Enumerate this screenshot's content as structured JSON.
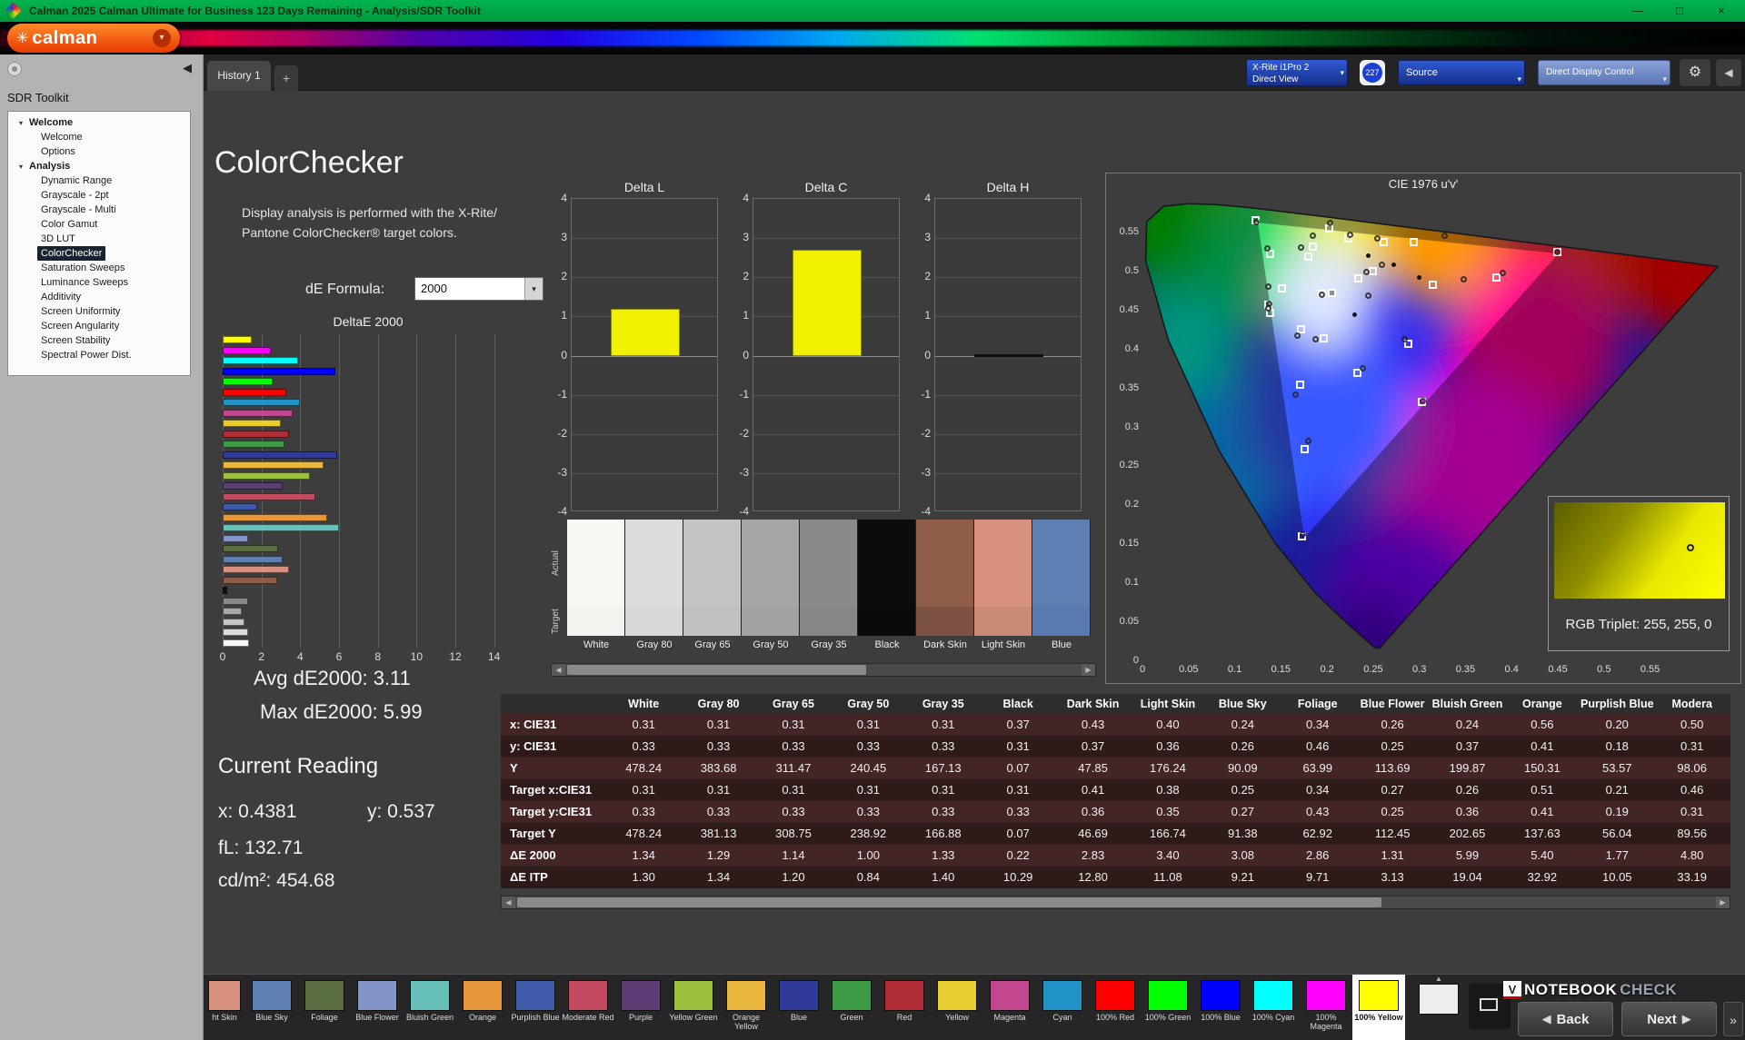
{
  "window": {
    "title": "Calman 2025 Calman Ultimate for Business 123 Days Remaining  - Analysis/SDR Toolkit",
    "controls": {
      "min": "—",
      "max": "□",
      "close": "×"
    }
  },
  "logo": {
    "text": "calman"
  },
  "icons": {
    "expanded": "▾",
    "dropdown": "▾",
    "left": "◀",
    "right": "▶",
    "up": "▲",
    "back": "◀",
    "next": "▶",
    "more": "»",
    "gear": "⚙",
    "plus": "+",
    "flower": "✳",
    "collapse_left": "◀"
  },
  "sidebar": {
    "title": "SDR Toolkit",
    "sections": [
      {
        "label": "Welcome",
        "items": [
          {
            "label": "Welcome"
          },
          {
            "label": "Options"
          }
        ]
      },
      {
        "label": "Analysis",
        "items": [
          {
            "label": "Dynamic Range"
          },
          {
            "label": "Grayscale - 2pt"
          },
          {
            "label": "Grayscale - Multi"
          },
          {
            "label": "Color Gamut"
          },
          {
            "label": "3D LUT"
          },
          {
            "label": "ColorChecker",
            "selected": true
          },
          {
            "label": "Saturation Sweeps"
          },
          {
            "label": "Luminance Sweeps"
          },
          {
            "label": "Additivity"
          },
          {
            "label": "Screen Uniformity"
          },
          {
            "label": "Screen Angularity"
          },
          {
            "label": "Screen Stability"
          },
          {
            "label": "Spectral Power Dist."
          }
        ]
      }
    ]
  },
  "toolbar": {
    "tab": "History 1",
    "meter": {
      "line1": "X-Rite i1Pro 2",
      "line2": "Direct View"
    },
    "badge": "227",
    "source_label": "Source",
    "ddc_label": "Direct Display Control"
  },
  "main": {
    "title": "ColorChecker",
    "description_line1": "Display analysis is performed with the X-Rite/",
    "description_line2": "Pantone ColorChecker® target colors.",
    "de_formula_label": "dE Formula:",
    "de_formula_value": "2000",
    "avg": "Avg dE2000: 3.11",
    "max": "Max dE2000: 5.99",
    "current_reading": {
      "title": "Current Reading",
      "x": "x: 0.4381",
      "y": "y: 0.537",
      "fl": "fL: 132.71",
      "cd": "cd/m²: 454.68"
    },
    "rgb_triplet": "RGB Triplet: 255, 255, 0"
  },
  "chart_data": [
    {
      "type": "bar",
      "orientation": "horizontal",
      "title": "DeltaE 2000",
      "xlim": [
        0,
        15
      ],
      "xticks": [
        0,
        2,
        4,
        6,
        8,
        10,
        12,
        14
      ],
      "note": "bars listed top-to-bottom; values are dE2000 per patch",
      "bars": [
        {
          "name": "100% Yellow",
          "value": 1.5,
          "color": "#ffff00"
        },
        {
          "name": "100% Magenta",
          "value": 2.5,
          "color": "#ff00ff"
        },
        {
          "name": "100% Cyan",
          "value": 3.9,
          "color": "#00ffff"
        },
        {
          "name": "100% Blue",
          "value": 5.8,
          "color": "#0000ff"
        },
        {
          "name": "100% Green",
          "value": 2.6,
          "color": "#00ff00"
        },
        {
          "name": "100% Red",
          "value": 3.3,
          "color": "#ff0000"
        },
        {
          "name": "Cyan",
          "value": 4.0,
          "color": "#1f93c6"
        },
        {
          "name": "Magenta",
          "value": 3.6,
          "color": "#c2478f"
        },
        {
          "name": "Yellow",
          "value": 3.0,
          "color": "#e8cc30"
        },
        {
          "name": "Red",
          "value": 3.4,
          "color": "#b02d37"
        },
        {
          "name": "Green",
          "value": 3.2,
          "color": "#3e9b45"
        },
        {
          "name": "Blue",
          "value": 5.9,
          "color": "#2f3a99"
        },
        {
          "name": "Orange Yellow",
          "value": 5.2,
          "color": "#e9b83c"
        },
        {
          "name": "Yellow Green",
          "value": 4.5,
          "color": "#9cc13c"
        },
        {
          "name": "Purple",
          "value": 3.1,
          "color": "#5e3c74"
        },
        {
          "name": "Moderate Red",
          "value": 4.8,
          "color": "#c34a5e"
        },
        {
          "name": "Purplish Blue",
          "value": 1.77,
          "color": "#3f5aa8"
        },
        {
          "name": "Orange",
          "value": 5.4,
          "color": "#e8963a"
        },
        {
          "name": "Bluish Green",
          "value": 5.99,
          "color": "#68c1b8"
        },
        {
          "name": "Blue Flower",
          "value": 1.31,
          "color": "#8295c8"
        },
        {
          "name": "Foliage",
          "value": 2.86,
          "color": "#5a6e41"
        },
        {
          "name": "Blue Sky",
          "value": 3.08,
          "color": "#5d7fb2"
        },
        {
          "name": "Light Skin",
          "value": 3.4,
          "color": "#d8917e"
        },
        {
          "name": "Dark Skin",
          "value": 2.83,
          "color": "#8f5c49"
        },
        {
          "name": "Black",
          "value": 0.22,
          "color": "#141414"
        },
        {
          "name": "Gray 35",
          "value": 1.33,
          "color": "#8a8a8a"
        },
        {
          "name": "Gray 50",
          "value": 1.0,
          "color": "#a8a8a6"
        },
        {
          "name": "Gray 65",
          "value": 1.14,
          "color": "#c6c6c4"
        },
        {
          "name": "Gray 80",
          "value": 1.29,
          "color": "#dcdcdc"
        },
        {
          "name": "White",
          "value": 1.34,
          "color": "#f5f5f2"
        }
      ]
    },
    {
      "type": "bar",
      "title": "Delta L",
      "ylim": [
        -4,
        4
      ],
      "yticks": [
        4,
        3,
        2,
        1,
        0,
        -1,
        -2,
        -3,
        -4
      ],
      "values": [
        1.2
      ],
      "bar_color": "#f0f000"
    },
    {
      "type": "bar",
      "title": "Delta C",
      "ylim": [
        -4,
        4
      ],
      "yticks": [
        4,
        3,
        2,
        1,
        0,
        -1,
        -2,
        -3,
        -4
      ],
      "values": [
        2.7
      ],
      "bar_color": "#f0f000"
    },
    {
      "type": "bar",
      "title": "Delta H",
      "ylim": [
        -4,
        4
      ],
      "yticks": [
        4,
        3,
        2,
        1,
        0,
        -1,
        -2,
        -3,
        -4
      ],
      "values": [
        -0.05
      ],
      "bar_color": "#101010"
    },
    {
      "type": "scatter",
      "title": "CIE 1976 u'v'",
      "xlim": [
        0,
        0.64
      ],
      "ylim": [
        0,
        0.6
      ],
      "xticks": [
        0,
        0.05,
        0.1,
        0.15,
        0.2,
        0.25,
        0.3,
        0.35,
        0.4,
        0.45,
        0.5,
        0.55
      ],
      "yticks": [
        0,
        0.05,
        0.1,
        0.15,
        0.2,
        0.25,
        0.3,
        0.35,
        0.4,
        0.45,
        0.5,
        0.55
      ],
      "legend": {
        "square": "target",
        "circle": "measured"
      },
      "targets": [
        [
          0.196,
          0.469
        ],
        [
          0.252,
          0.498
        ],
        [
          0.236,
          0.489
        ],
        [
          0.174,
          0.423
        ],
        [
          0.182,
          0.517
        ],
        [
          0.198,
          0.412
        ],
        [
          0.153,
          0.476
        ],
        [
          0.296,
          0.535
        ],
        [
          0.173,
          0.352
        ],
        [
          0.317,
          0.481
        ],
        [
          0.235,
          0.368
        ],
        [
          0.187,
          0.53
        ],
        [
          0.263,
          0.535
        ],
        [
          0.178,
          0.27
        ],
        [
          0.14,
          0.52
        ],
        [
          0.385,
          0.49
        ],
        [
          0.225,
          0.54
        ],
        [
          0.29,
          0.405
        ],
        [
          0.14,
          0.445
        ],
        [
          0.451,
          0.523
        ],
        [
          0.125,
          0.563
        ],
        [
          0.175,
          0.158
        ],
        [
          0.138,
          0.455
        ],
        [
          0.305,
          0.33
        ],
        [
          0.204,
          0.553
        ]
      ],
      "measured": [
        [
          0.196,
          0.468
        ],
        [
          0.247,
          0.467
        ],
        [
          0.261,
          0.506
        ],
        [
          0.245,
          0.497
        ],
        [
          0.17,
          0.415
        ],
        [
          0.174,
          0.528
        ],
        [
          0.19,
          0.411
        ],
        [
          0.138,
          0.478
        ],
        [
          0.329,
          0.543
        ],
        [
          0.168,
          0.34
        ],
        [
          0.35,
          0.488
        ],
        [
          0.241,
          0.373
        ],
        [
          0.187,
          0.543
        ],
        [
          0.256,
          0.54
        ],
        [
          0.182,
          0.28
        ],
        [
          0.137,
          0.527
        ],
        [
          0.392,
          0.496
        ],
        [
          0.227,
          0.545
        ],
        [
          0.286,
          0.411
        ],
        [
          0.138,
          0.45
        ],
        [
          0.451,
          0.522
        ],
        [
          0.126,
          0.561
        ],
        [
          0.176,
          0.16
        ],
        [
          0.139,
          0.456
        ],
        [
          0.306,
          0.331
        ],
        [
          0.205,
          0.56
        ]
      ],
      "reference_dots": [
        [
          0.245,
          0.52
        ],
        [
          0.272,
          0.508
        ],
        [
          0.3,
          0.492
        ],
        [
          0.23,
          0.445
        ]
      ],
      "selected": [
        0.207,
        0.47
      ]
    }
  ],
  "swatch_strip": {
    "row_labels": [
      "Actual",
      "Target"
    ],
    "patches": [
      {
        "label": "White",
        "actual": "#f7f7f4",
        "target": "#f2f2ef"
      },
      {
        "label": "Gray 80",
        "actual": "#dcdcdc",
        "target": "#d8d8d8"
      },
      {
        "label": "Gray 65",
        "actual": "#c4c4c2",
        "target": "#c0c0be"
      },
      {
        "label": "Gray 50",
        "actual": "#a6a6a4",
        "target": "#a2a2a0"
      },
      {
        "label": "Gray 35",
        "actual": "#8a8a8a",
        "target": "#868686"
      },
      {
        "label": "Black",
        "actual": "#0c0c0e",
        "target": "#0a0a0a"
      },
      {
        "label": "Dark Skin",
        "actual": "#8f5c49",
        "target": "#7d5243"
      },
      {
        "label": "Light Skin",
        "actual": "#d8917e",
        "target": "#c98a74"
      },
      {
        "label": "Blue",
        "actual": "#5d7fb2",
        "target": "#597ab0"
      }
    ]
  },
  "table": {
    "columns": [
      "White",
      "Gray 80",
      "Gray 65",
      "Gray 50",
      "Gray 35",
      "Black",
      "Dark Skin",
      "Light Skin",
      "Blue Sky",
      "Foliage",
      "Blue Flower",
      "Bluish Green",
      "Orange",
      "Purplish Blue",
      "Modera"
    ],
    "rows": [
      {
        "label": "x: CIE31",
        "values": [
          "0.31",
          "0.31",
          "0.31",
          "0.31",
          "0.31",
          "0.37",
          "0.43",
          "0.40",
          "0.24",
          "0.34",
          "0.26",
          "0.24",
          "0.56",
          "0.20",
          "0.50"
        ]
      },
      {
        "label": "y: CIE31",
        "values": [
          "0.33",
          "0.33",
          "0.33",
          "0.33",
          "0.33",
          "0.31",
          "0.37",
          "0.36",
          "0.26",
          "0.46",
          "0.25",
          "0.37",
          "0.41",
          "0.18",
          "0.31"
        ]
      },
      {
        "label": "Y",
        "values": [
          "478.24",
          "383.68",
          "311.47",
          "240.45",
          "167.13",
          "0.07",
          "47.85",
          "176.24",
          "90.09",
          "63.99",
          "113.69",
          "199.87",
          "150.31",
          "53.57",
          "98.06"
        ]
      },
      {
        "label": "Target x:CIE31",
        "values": [
          "0.31",
          "0.31",
          "0.31",
          "0.31",
          "0.31",
          "0.31",
          "0.41",
          "0.38",
          "0.25",
          "0.34",
          "0.27",
          "0.26",
          "0.51",
          "0.21",
          "0.46"
        ]
      },
      {
        "label": "Target y:CIE31",
        "values": [
          "0.33",
          "0.33",
          "0.33",
          "0.33",
          "0.33",
          "0.33",
          "0.36",
          "0.35",
          "0.27",
          "0.43",
          "0.25",
          "0.36",
          "0.41",
          "0.19",
          "0.31"
        ]
      },
      {
        "label": "Target Y",
        "values": [
          "478.24",
          "381.13",
          "308.75",
          "238.92",
          "166.88",
          "0.07",
          "46.69",
          "166.74",
          "91.38",
          "62.92",
          "112.45",
          "202.65",
          "137.63",
          "56.04",
          "89.56"
        ]
      },
      {
        "label": "ΔE 2000",
        "values": [
          "1.34",
          "1.29",
          "1.14",
          "1.00",
          "1.33",
          "0.22",
          "2.83",
          "3.40",
          "3.08",
          "2.86",
          "1.31",
          "5.99",
          "5.40",
          "1.77",
          "4.80"
        ]
      },
      {
        "label": "ΔE ITP",
        "values": [
          "1.30",
          "1.34",
          "1.20",
          "0.84",
          "1.40",
          "10.29",
          "12.80",
          "11.08",
          "9.21",
          "9.71",
          "3.13",
          "19.04",
          "32.92",
          "10.05",
          "33.19"
        ]
      }
    ]
  },
  "bottom_bar": {
    "patches": [
      {
        "label": "ht Skin",
        "color": "#d8917e"
      },
      {
        "label": "Blue Sky",
        "color": "#5d7fb2"
      },
      {
        "label": "Foliage",
        "color": "#5a6e41"
      },
      {
        "label": "Blue Flower",
        "color": "#8295c8"
      },
      {
        "label": "Bluish Green",
        "color": "#68c1b8"
      },
      {
        "label": "Orange",
        "color": "#e8963a"
      },
      {
        "label": "Purplish Blue",
        "color": "#3f5aa8"
      },
      {
        "label": "Moderate Red",
        "color": "#c34a5e"
      },
      {
        "label": "Purple",
        "color": "#5e3c74"
      },
      {
        "label": "Yellow Green",
        "color": "#9cc13c"
      },
      {
        "label": "Orange Yellow",
        "color": "#e9b83c"
      },
      {
        "label": "Blue",
        "color": "#2f3a99"
      },
      {
        "label": "Green",
        "color": "#3e9b45"
      },
      {
        "label": "Red",
        "color": "#b02d37"
      },
      {
        "label": "Yellow",
        "color": "#e8cc30"
      },
      {
        "label": "Magenta",
        "color": "#c2478f"
      },
      {
        "label": "Cyan",
        "color": "#1f93c6"
      },
      {
        "label": "100% Red",
        "color": "#ff0000"
      },
      {
        "label": "100% Green",
        "color": "#00ff00"
      },
      {
        "label": "100% Blue",
        "color": "#0000ff"
      },
      {
        "label": "100% Cyan",
        "color": "#00ffff"
      },
      {
        "label": "100% Magenta",
        "color": "#ff00ff"
      },
      {
        "label": "100% Yellow",
        "color": "#ffff00",
        "selected": true
      }
    ],
    "back": "Back",
    "next": "Next",
    "more": "»"
  },
  "watermark": {
    "v": "V",
    "part1": "NOTEBOOK",
    "part2": "CHECK"
  }
}
